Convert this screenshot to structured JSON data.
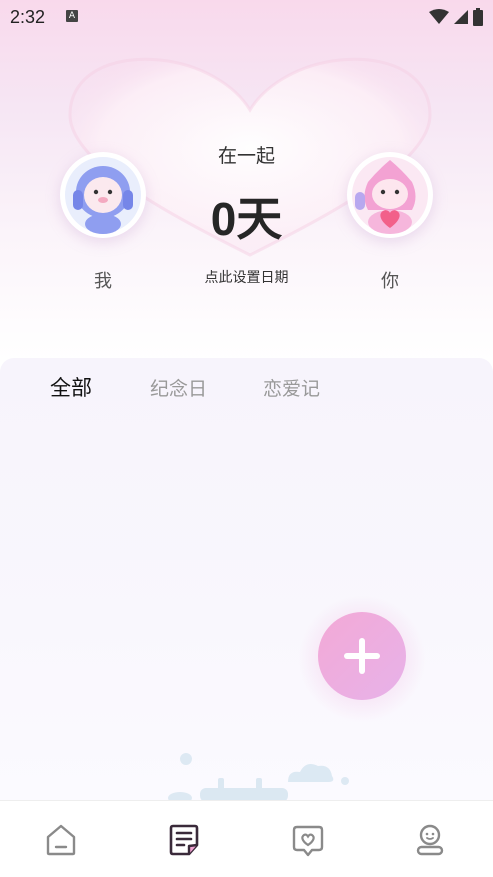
{
  "status_bar": {
    "time": "2:32",
    "a_badge": "A"
  },
  "header": {
    "together_label": "在一起",
    "days_value": "0",
    "days_unit": "天",
    "set_date_label": "点此设置日期",
    "me_label": "我",
    "you_label": "你"
  },
  "tabs": [
    {
      "label": "全部",
      "active": true
    },
    {
      "label": "纪念日",
      "active": false
    },
    {
      "label": "恋爱记",
      "active": false
    }
  ],
  "fab_icon": "plus-icon",
  "bottom_nav": [
    {
      "icon": "home-icon",
      "active": false
    },
    {
      "icon": "notes-icon",
      "active": true
    },
    {
      "icon": "love-chat-icon",
      "active": false
    },
    {
      "icon": "profile-icon",
      "active": false
    }
  ],
  "colors": {
    "accent_pink": "#f3a9d6",
    "accent_purple": "#e7b2e9",
    "active_nav": "#3a2a3a",
    "inactive_nav": "#8a8a8a"
  }
}
